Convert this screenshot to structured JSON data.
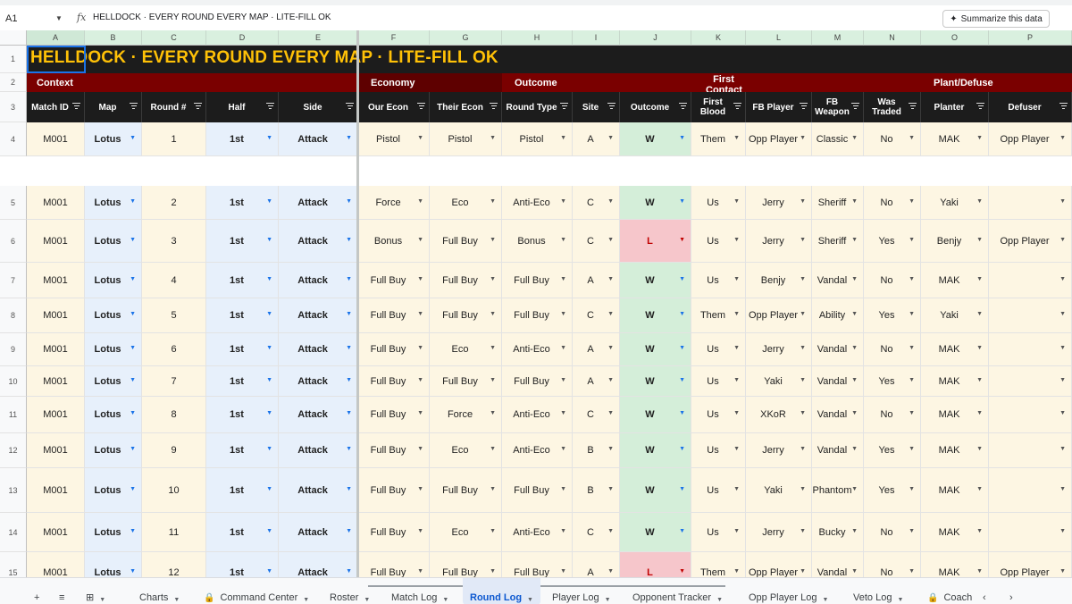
{
  "formula_bar": {
    "cell_ref": "A1",
    "fx": "fx",
    "formula": "HELLDOCK · EVERY ROUND EVERY MAP · LITE-FILL OK",
    "summarize": "Summarize this data"
  },
  "columns": [
    "A",
    "B",
    "C",
    "D",
    "E",
    "F",
    "G",
    "H",
    "I",
    "J",
    "K",
    "L",
    "M",
    "N",
    "O",
    "P"
  ],
  "row_numbers": [
    "1",
    "2",
    "3",
    "4",
    "5",
    "6",
    "7",
    "8",
    "9",
    "10",
    "11",
    "12",
    "13",
    "14",
    "15"
  ],
  "title": "HELLDOCK  ·  EVERY ROUND EVERY MAP  ·  LITE-FILL OK",
  "section_headers": {
    "context": "Context",
    "economy": "Economy",
    "outcome": "Outcome",
    "first_contact": "First Contact",
    "plant_defuse": "Plant/Defuse"
  },
  "headers": [
    "Match ID",
    "Map",
    "Round #",
    "Half",
    "Side",
    "Our Econ",
    "Their Econ",
    "Round Type",
    "Site",
    "Outcome",
    "First Blood",
    "FB Player",
    "FB Weapon",
    "Was Traded",
    "Planter",
    "Defuser"
  ],
  "rows": [
    [
      "M001",
      "Lotus",
      "1",
      "1st",
      "Attack",
      "Pistol",
      "Pistol",
      "Pistol",
      "A",
      "W",
      "Them",
      "Opp Player",
      "Classic",
      "No",
      "MAK",
      "Opp Player"
    ],
    [
      "M001",
      "Lotus",
      "2",
      "1st",
      "Attack",
      "Force",
      "Eco",
      "Anti-Eco",
      "C",
      "W",
      "Us",
      "Jerry",
      "Sheriff",
      "No",
      "Yaki",
      ""
    ],
    [
      "M001",
      "Lotus",
      "3",
      "1st",
      "Attack",
      "Bonus",
      "Full Buy",
      "Bonus",
      "C",
      "L",
      "Us",
      "Jerry",
      "Sheriff",
      "Yes",
      "Benjy",
      "Opp Player"
    ],
    [
      "M001",
      "Lotus",
      "4",
      "1st",
      "Attack",
      "Full Buy",
      "Full Buy",
      "Full Buy",
      "A",
      "W",
      "Us",
      "Benjy",
      "Vandal",
      "No",
      "MAK",
      ""
    ],
    [
      "M001",
      "Lotus",
      "5",
      "1st",
      "Attack",
      "Full Buy",
      "Full Buy",
      "Full Buy",
      "C",
      "W",
      "Them",
      "Opp Player",
      "Ability",
      "Yes",
      "Yaki",
      ""
    ],
    [
      "M001",
      "Lotus",
      "6",
      "1st",
      "Attack",
      "Full Buy",
      "Eco",
      "Anti-Eco",
      "A",
      "W",
      "Us",
      "Jerry",
      "Vandal",
      "No",
      "MAK",
      ""
    ],
    [
      "M001",
      "Lotus",
      "7",
      "1st",
      "Attack",
      "Full Buy",
      "Full Buy",
      "Full Buy",
      "A",
      "W",
      "Us",
      "Yaki",
      "Vandal",
      "Yes",
      "MAK",
      ""
    ],
    [
      "M001",
      "Lotus",
      "8",
      "1st",
      "Attack",
      "Full Buy",
      "Force",
      "Anti-Eco",
      "C",
      "W",
      "Us",
      "XKoR",
      "Vandal",
      "No",
      "MAK",
      ""
    ],
    [
      "M001",
      "Lotus",
      "9",
      "1st",
      "Attack",
      "Full Buy",
      "Eco",
      "Anti-Eco",
      "B",
      "W",
      "Us",
      "Jerry",
      "Vandal",
      "Yes",
      "MAK",
      ""
    ],
    [
      "M001",
      "Lotus",
      "10",
      "1st",
      "Attack",
      "Full Buy",
      "Full Buy",
      "Full Buy",
      "B",
      "W",
      "Us",
      "Yaki",
      "Phantom",
      "Yes",
      "MAK",
      ""
    ],
    [
      "M001",
      "Lotus",
      "11",
      "1st",
      "Attack",
      "Full Buy",
      "Eco",
      "Anti-Eco",
      "C",
      "W",
      "Us",
      "Jerry",
      "Bucky",
      "No",
      "MAK",
      ""
    ],
    [
      "M001",
      "Lotus",
      "12",
      "1st",
      "Attack",
      "Full Buy",
      "Full Buy",
      "Full Buy",
      "A",
      "L",
      "Them",
      "Opp Player",
      "Vandal",
      "No",
      "MAK",
      "Opp Player"
    ]
  ],
  "colors": {
    "win": "#d4eed9",
    "loss": "#f6c6cb",
    "context_blue": "#e7f0fb",
    "cream": "#fdf6e3",
    "section_red": "#7a0000",
    "title_yellow": "#ffc107",
    "accent": "#1a73e8"
  },
  "sheet_tabs": [
    {
      "label": "Charts",
      "icon": ""
    },
    {
      "label": "Command Center",
      "icon": "lock-icon"
    },
    {
      "label": "Roster",
      "icon": ""
    },
    {
      "label": "Match Log",
      "icon": ""
    },
    {
      "label": "Round Log",
      "icon": "",
      "active": true
    },
    {
      "label": "Player Log",
      "icon": ""
    },
    {
      "label": "Opponent Tracker",
      "icon": ""
    },
    {
      "label": "Opp Player Log",
      "icon": ""
    },
    {
      "label": "Veto Log",
      "icon": ""
    },
    {
      "label": "Coach",
      "icon": "lock-icon"
    }
  ]
}
